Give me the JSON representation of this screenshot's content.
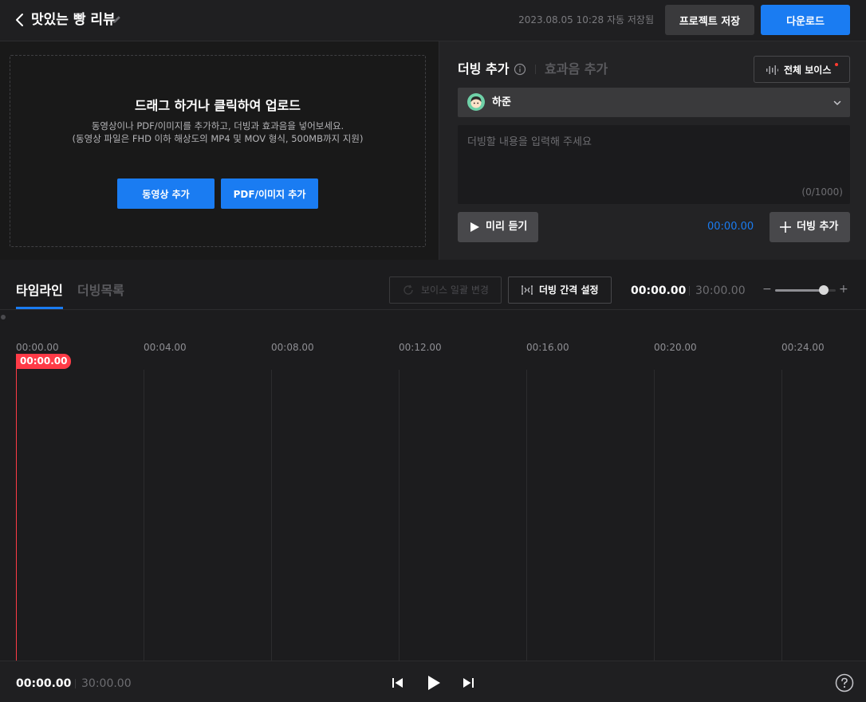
{
  "header": {
    "project_title": "맛있는 빵 리뷰",
    "autosave": "2023.08.05 10:28 자동 저장됨",
    "save_label": "프로젝트 저장",
    "download_label": "다운로드"
  },
  "upload": {
    "title": "드래그 하거나 클릭하여 업로드",
    "desc_line1": "동영상이나 PDF/이미지를 추가하고, 더빙과 효과음을 넣어보세요.",
    "desc_line2": "(동영상 파일은 FHD 이하 해상도의 MP4 및 MOV 형식, 500MB까지 지원)",
    "add_video_label": "동영상 추가",
    "add_pdf_label": "PDF/이미지 추가"
  },
  "dubbing": {
    "tab_dub": "더빙 추가",
    "tab_sfx": "효과음 추가",
    "all_voice_label": "전체 보이스",
    "selected_voice": "하준",
    "text_placeholder": "더빙할 내용을 입력해 주세요",
    "char_count": "(0/1000)",
    "preview_label": "미리 듣기",
    "time": "00:00.00",
    "add_dub_label": "더빙 추가"
  },
  "timeline": {
    "tab_timeline": "타임라인",
    "tab_dub_list": "더빙목록",
    "voice_batch_label": "보이스 일괄 변경",
    "interval_label": "더빙 간격 설정",
    "current_time": "00:00.00",
    "total_time": "30:00.00",
    "zoom_level": 0.8,
    "ticks": [
      "00:00.00",
      "00:04.00",
      "00:08.00",
      "00:12.00",
      "00:16.00",
      "00:20.00",
      "00:24.00"
    ],
    "playhead_label": "00:00.00"
  },
  "footer": {
    "current_time": "00:00.00",
    "total_time": "30:00.00"
  },
  "colors": {
    "accent": "#1a7cf2",
    "playhead": "#ff3b47",
    "background": "#1c1c1e"
  },
  "icons": [
    "chevron-left-icon",
    "pencil-icon",
    "info-icon",
    "waveform-icon",
    "chevron-down-icon",
    "play-icon",
    "plus-icon",
    "refresh-icon",
    "interval-icon",
    "skip-previous-icon",
    "skip-next-icon",
    "help-icon"
  ]
}
